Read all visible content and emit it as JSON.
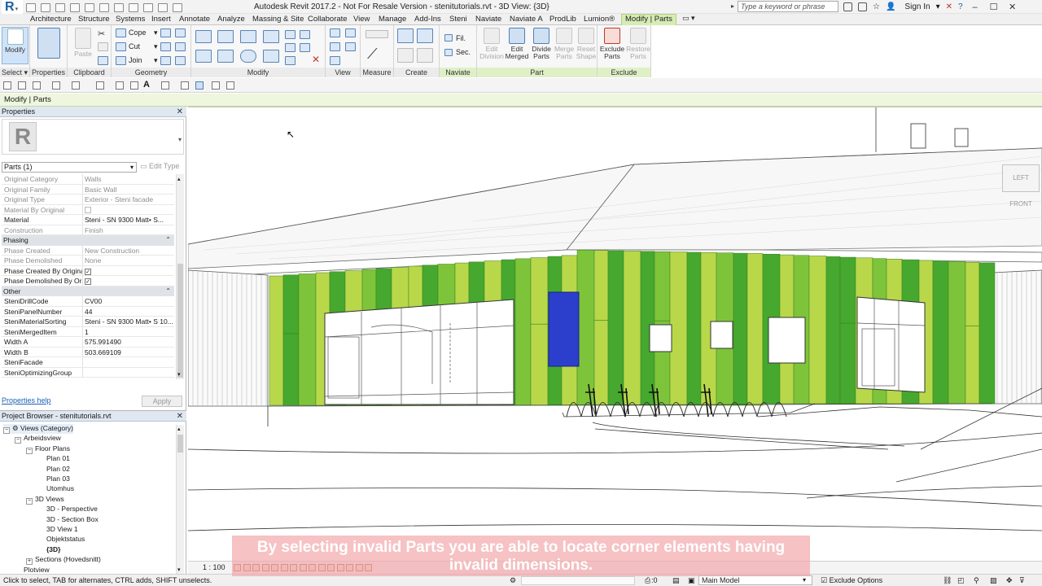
{
  "window": {
    "title": "Autodesk Revit 2017.2 - Not For Resale Version -    stenitutorials.rvt - 3D View: {3D}",
    "search_placeholder": "Type a keyword or phrase",
    "sign_in": "Sign In"
  },
  "tabs": [
    "Architecture",
    "Structure",
    "Systems",
    "Insert",
    "Annotate",
    "Analyze",
    "Massing & Site",
    "Collaborate",
    "View",
    "Manage",
    "Add-Ins",
    "Steni",
    "Naviate",
    "Naviate A",
    "ProdLib",
    "Lumion®",
    "Modify | Parts"
  ],
  "ribbon": {
    "modify_label": "Modify",
    "panels": {
      "select": "Select",
      "properties": "Properties",
      "clipboard": "Clipboard",
      "geometry": "Geometry",
      "modify": "Modify",
      "view": "View",
      "measure": "Measure",
      "create": "Create",
      "naviate": "Naviate",
      "part": "Part",
      "exclude": "Exclude"
    },
    "paste": "Paste",
    "cope": "Cope",
    "cut": "Cut",
    "join": "Join",
    "fil": "Fil.",
    "sec": "Sec.",
    "part_buttons": [
      "Edit Division",
      "Edit Merged",
      "Divide Parts",
      "Merge Parts",
      "Reset Shape"
    ],
    "exclude_buttons": [
      "Exclude Parts",
      "Restore Parts"
    ]
  },
  "context_bar": "Modify | Parts",
  "properties": {
    "title": "Properties",
    "type_selector": "Parts (1)",
    "edit_type": "Edit Type",
    "rows": [
      {
        "k": "Original Category",
        "v": "Walls",
        "dis": true
      },
      {
        "k": "Original Family",
        "v": "Basic Wall",
        "dis": true
      },
      {
        "k": "Original Type",
        "v": "Exterior - Steni facade",
        "dis": true
      },
      {
        "k": "Material By Original",
        "v": "",
        "cb": "empty",
        "dis": true
      },
      {
        "k": "Material",
        "v": "Steni - SN 9300 Matt• S...",
        "dis": false
      },
      {
        "k": "Construction",
        "v": "Finish",
        "dis": true
      }
    ],
    "group_phasing": "Phasing",
    "phasing_rows": [
      {
        "k": "Phase Created",
        "v": "New Construction",
        "dis": true
      },
      {
        "k": "Phase Demolished",
        "v": "None",
        "dis": true
      },
      {
        "k": "Phase Created By Original",
        "v": "",
        "cb": "checked",
        "dis": false
      },
      {
        "k": "Phase Demolished By Or...",
        "v": "",
        "cb": "checked",
        "dis": false
      }
    ],
    "group_other": "Other",
    "other_rows": [
      {
        "k": "SteniDrillCode",
        "v": "CV00"
      },
      {
        "k": "SteniPanelNumber",
        "v": "44"
      },
      {
        "k": "SteniMaterialSorting",
        "v": "Steni - SN 9300 Matt• S 10..."
      },
      {
        "k": "SteniMergedItem",
        "v": "1"
      },
      {
        "k": "Width A",
        "v": "575.991490"
      },
      {
        "k": "Width B",
        "v": "503.669109"
      },
      {
        "k": "SteniFacade",
        "v": ""
      },
      {
        "k": "SteniOptimizingGroup",
        "v": ""
      }
    ],
    "help": "Properties help",
    "apply": "Apply"
  },
  "browser": {
    "title": "Project Browser - stenitutorials.rvt",
    "items": [
      {
        "t": "Views (Category)",
        "lvl": 0,
        "exp": "-"
      },
      {
        "t": "Arbeidsview",
        "lvl": 1,
        "exp": "-"
      },
      {
        "t": "Floor Plans",
        "lvl": 2,
        "exp": "-"
      },
      {
        "t": "Plan 01",
        "lvl": 3,
        "exp": ""
      },
      {
        "t": "Plan 02",
        "lvl": 3,
        "exp": ""
      },
      {
        "t": "Plan 03",
        "lvl": 3,
        "exp": ""
      },
      {
        "t": "Utomhus",
        "lvl": 3,
        "exp": ""
      },
      {
        "t": "3D Views",
        "lvl": 2,
        "exp": "-"
      },
      {
        "t": "3D - Perspective",
        "lvl": 3,
        "exp": ""
      },
      {
        "t": "3D - Section Box",
        "lvl": 3,
        "exp": ""
      },
      {
        "t": "3D View 1",
        "lvl": 3,
        "exp": ""
      },
      {
        "t": "Objektstatus",
        "lvl": 3,
        "exp": ""
      },
      {
        "t": "{3D}",
        "lvl": 3,
        "exp": "",
        "bold": true
      },
      {
        "t": "Sections (Hovedsnitt)",
        "lvl": 2,
        "exp": "+"
      },
      {
        "t": "Plotview",
        "lvl": 1,
        "exp": ""
      }
    ]
  },
  "viewcube": {
    "left": "LEFT",
    "front": "FRONT"
  },
  "view_scale": "1 : 100",
  "status": {
    "text": "Click to select, TAB for alternates, CTRL adds, SHIFT unselects.",
    "zero": ":0",
    "model": "Main Model",
    "exclude": "Exclude Options"
  },
  "subtitle": "By selecting invalid Parts you are able to locate corner elements having invalid dimensions.",
  "colors": {
    "panel_dark": "#46a82e",
    "panel_light": "#b8d84a",
    "panel_mid": "#7ec43a",
    "selected_panel": "#2c3fcc",
    "context_tab": "#d6ecb4"
  }
}
